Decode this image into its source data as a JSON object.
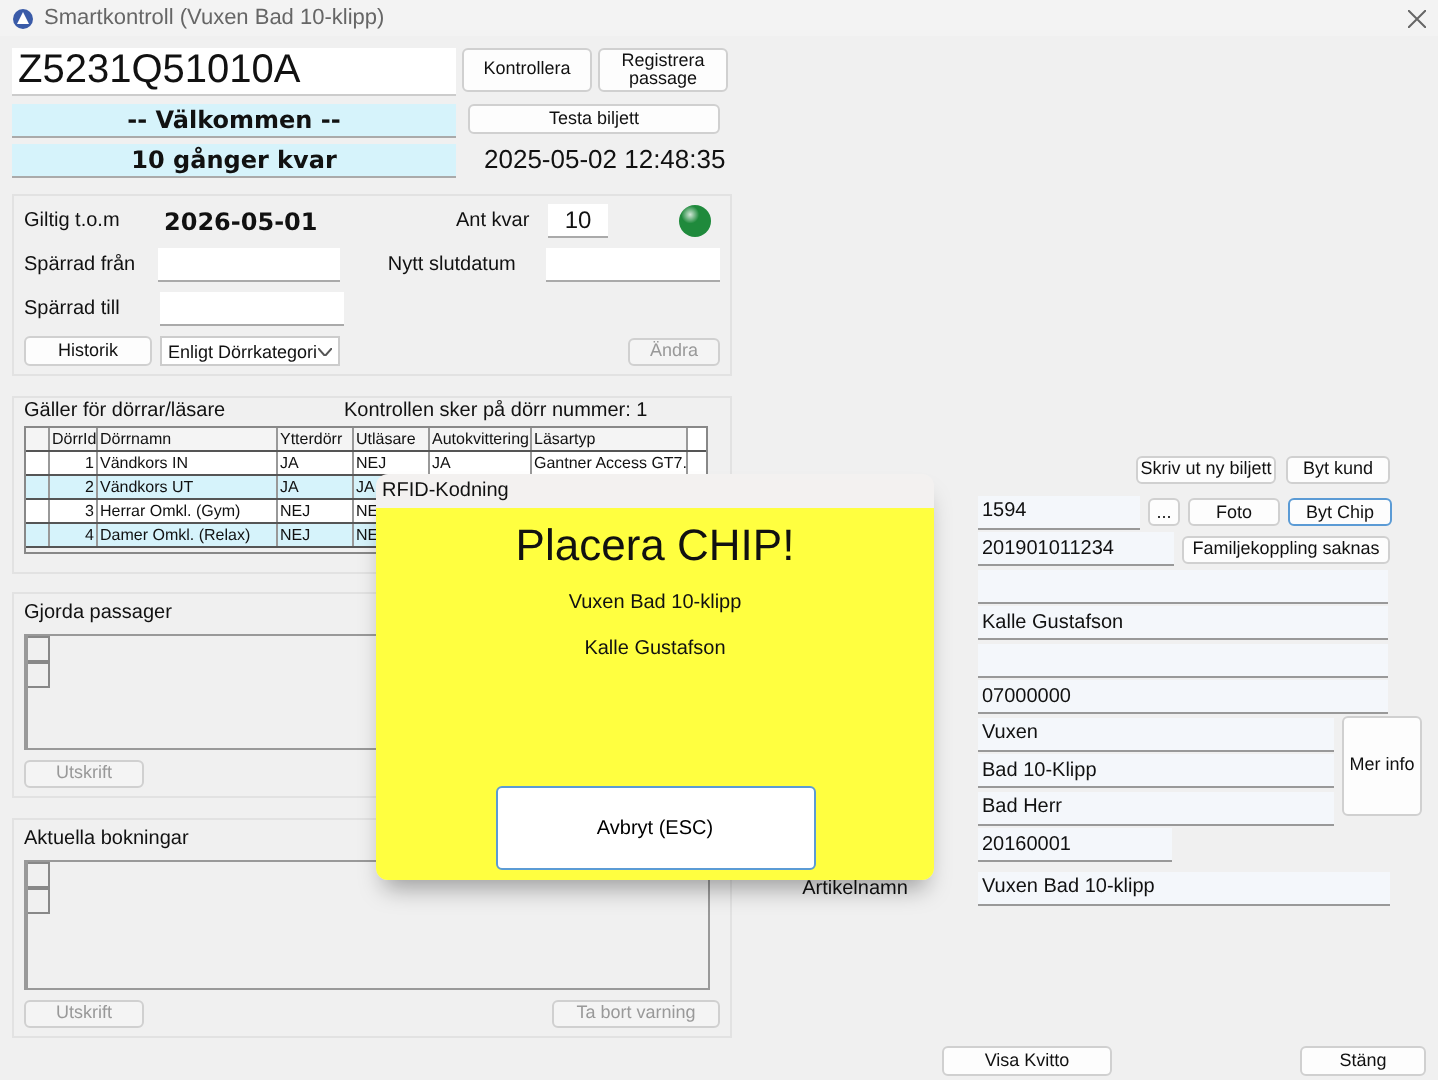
{
  "window": {
    "title": "Smartkontroll  (Vuxen Bad 10-klipp)"
  },
  "card_number": "Z5231Q51010A",
  "top_buttons": [
    "Kontrollera",
    "Registrera passage"
  ],
  "welcome": "-- Välkommen  --",
  "remaining": "10 gånger kvar",
  "test_button": "Testa biljett",
  "datetime": "2025-05-02 12:48:35",
  "validity": {
    "valid_label": "Giltig t.o.m",
    "valid_date": "2026-05-01",
    "count_label": "Ant kvar",
    "count": "10",
    "blocked_from_label": "Spärrad från",
    "new_end_label": "Nytt slutdatum",
    "blocked_to_label": "Spärrad till",
    "history_button": "Historik",
    "door_filter": "Enligt Dörrkategori",
    "change_button": {
      "label": "Ändra",
      "disabled": true
    }
  },
  "doors": {
    "title": "Gäller för dörrar/läsare",
    "note": "Kontrollen sker på dörr nummer: 1",
    "columns": [
      "DörrId",
      "Dörrnamn",
      "Ytterdörr",
      "Utläsare",
      "Autokvittering",
      "Läsartyp"
    ],
    "rows": [
      {
        "cells": [
          "1",
          "Vändkors IN",
          "JA",
          "NEJ",
          "JA",
          "Gantner Access GT7."
        ]
      },
      {
        "cells": [
          "2",
          "Vändkors UT",
          "JA",
          "JA"
        ]
      },
      {
        "cells": [
          "3",
          "Herrar Omkl. (Gym)",
          "NEJ",
          "NE"
        ]
      },
      {
        "cells": [
          "4",
          "Damer Omkl. (Relax)",
          "NEJ",
          "NE"
        ]
      }
    ]
  },
  "passages": {
    "title": "Gjorda passager",
    "print_button": {
      "label": "Utskrift",
      "disabled": true
    }
  },
  "bookings": {
    "title": "Aktuella bokningar",
    "print_button": {
      "label": "Utskrift",
      "disabled": true
    },
    "remove_warning_button": {
      "label": "Ta bort varning",
      "disabled": true
    }
  },
  "customer": {
    "print_ticket_button": "Skriv ut ny biljett",
    "switch_customer_button": "Byt kund",
    "customer_number": "1594",
    "more_button": "...",
    "photo_button": "Foto",
    "chip_button": {
      "label": "Byt Chip",
      "focused": true
    },
    "personal_number": "201901011234",
    "family_button": "Familjekoppling saknas",
    "details": [
      {
        "kind": "empty"
      },
      {
        "kind": "text",
        "value": "Kalle Gustafson"
      },
      {
        "kind": "empty"
      },
      {
        "kind": "text",
        "value": "07000000"
      }
    ],
    "categories": [
      "Vuxen",
      "Bad 10-Klipp",
      "Bad Herr"
    ],
    "info_button": "Mer info",
    "ticket_number": "20160001",
    "article_label": "Artikelnamn",
    "article_name": "Vuxen Bad 10-klipp"
  },
  "footer": {
    "receipt_button": "Visa Kvitto",
    "close_button": "Stäng"
  },
  "dialog": {
    "title": "RFID-Kodning",
    "heading": "Placera CHIP!",
    "lines": [
      "Vuxen Bad 10-klipp",
      "Kalle Gustafson"
    ],
    "cancel_button": "Avbryt (ESC)"
  }
}
